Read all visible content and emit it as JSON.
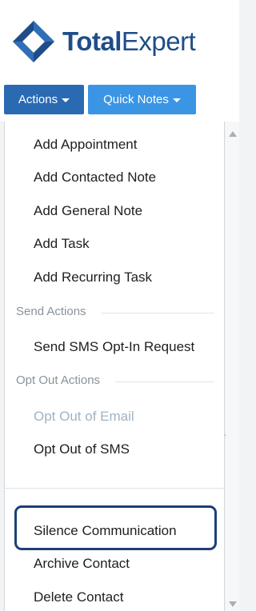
{
  "brand": {
    "name_part1": "Total",
    "name_part2": "Expert",
    "color": "#1f4d87"
  },
  "toolbar": {
    "actions_label": "Actions",
    "quick_notes_label": "Quick Notes",
    "actions_color": "#2a6ab3",
    "quick_notes_color": "#3a95e4"
  },
  "menu": {
    "items": [
      {
        "label": "Add Appointment"
      },
      {
        "label": "Add Contacted Note"
      },
      {
        "label": "Add General Note"
      },
      {
        "label": "Add Task"
      },
      {
        "label": "Add Recurring Task"
      }
    ],
    "send_actions": {
      "header": "Send Actions",
      "items": [
        {
          "label": "Send SMS Opt-In Request"
        }
      ]
    },
    "opt_out_actions": {
      "header": "Opt Out Actions",
      "items": [
        {
          "label": "Opt Out of Email",
          "disabled": true
        },
        {
          "label": "Opt Out of SMS"
        }
      ]
    },
    "bottom_items": [
      {
        "label": "Silence Communication",
        "highlighted": true
      },
      {
        "label": "Archive Contact"
      },
      {
        "label": "Delete Contact"
      }
    ],
    "highlight_color": "#1b3f78"
  },
  "icons": {
    "scroll_up": "scroll-up-arrow-icon",
    "scroll_down": "scroll-down-arrow-icon",
    "caret": "caret-down-icon"
  }
}
